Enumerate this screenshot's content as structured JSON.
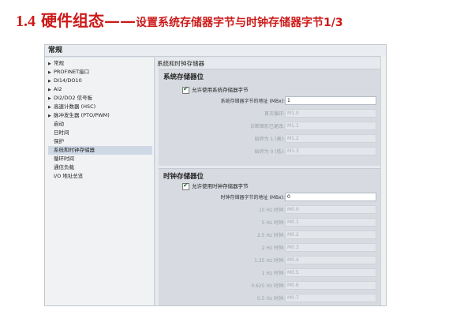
{
  "slide": {
    "title_number": "1.4",
    "title_main": " 硬件组态——",
    "title_rest": "设置系统存储器字节与时钟存储器字节1/3"
  },
  "window": {
    "header": "常规"
  },
  "nav": {
    "items": [
      {
        "label": "常规",
        "expandable": true
      },
      {
        "label": "PROFINET接口",
        "expandable": true
      },
      {
        "label": "DI14/DO10",
        "expandable": true
      },
      {
        "label": "AI2",
        "expandable": true
      },
      {
        "label": "DI2/DO2 信号板",
        "expandable": true
      },
      {
        "label": "高速计数器 (HSC)",
        "expandable": true
      },
      {
        "label": "脉冲发生器 (PTO/PWM)",
        "expandable": true
      },
      {
        "label": "启动",
        "expandable": false
      },
      {
        "label": "日时间",
        "expandable": false
      },
      {
        "label": "保护",
        "expandable": false
      },
      {
        "label": "系统和时钟存储器",
        "expandable": false,
        "selected": true
      },
      {
        "label": "循环时间",
        "expandable": false
      },
      {
        "label": "通信负载",
        "expandable": false
      },
      {
        "label": "I/O 地址总览",
        "expandable": false
      }
    ]
  },
  "content": {
    "section_title": "系统和时钟存储器",
    "system_memory": {
      "title": "系统存储器位",
      "enable_label": "允许使用系统存储器字节",
      "enabled": true,
      "address_label": "系统存储器字节的地址 (MBx):",
      "address_value": "1",
      "bits": [
        {
          "label": "首次循环:",
          "value": "M1.0"
        },
        {
          "label": "诊断图形已更改:",
          "value": "M1.1"
        },
        {
          "label": "始终为 1 (高):",
          "value": "M1.2"
        },
        {
          "label": "始终为 0 (低):",
          "value": "M1.3"
        }
      ]
    },
    "clock_memory": {
      "title": "时钟存储器位",
      "enable_label": "允许使用时钟存储器字节",
      "enabled": true,
      "address_label": "时钟存储器字节的地址 (MBx):",
      "address_value": "0",
      "bits": [
        {
          "label": "10 Hz 时钟:",
          "value": "M0.0"
        },
        {
          "label": "5 Hz 时钟:",
          "value": "M0.1"
        },
        {
          "label": "2.5 Hz 时钟:",
          "value": "M0.2"
        },
        {
          "label": "2 Hz 时钟:",
          "value": "M0.3"
        },
        {
          "label": "1.25 Hz 时钟:",
          "value": "M0.4"
        },
        {
          "label": "1 Hz 时钟:",
          "value": "M0.5"
        },
        {
          "label": "0.625 Hz 时钟:",
          "value": "M0.6"
        },
        {
          "label": "0.5 Hz 时钟:",
          "value": "M0.7"
        }
      ]
    }
  }
}
